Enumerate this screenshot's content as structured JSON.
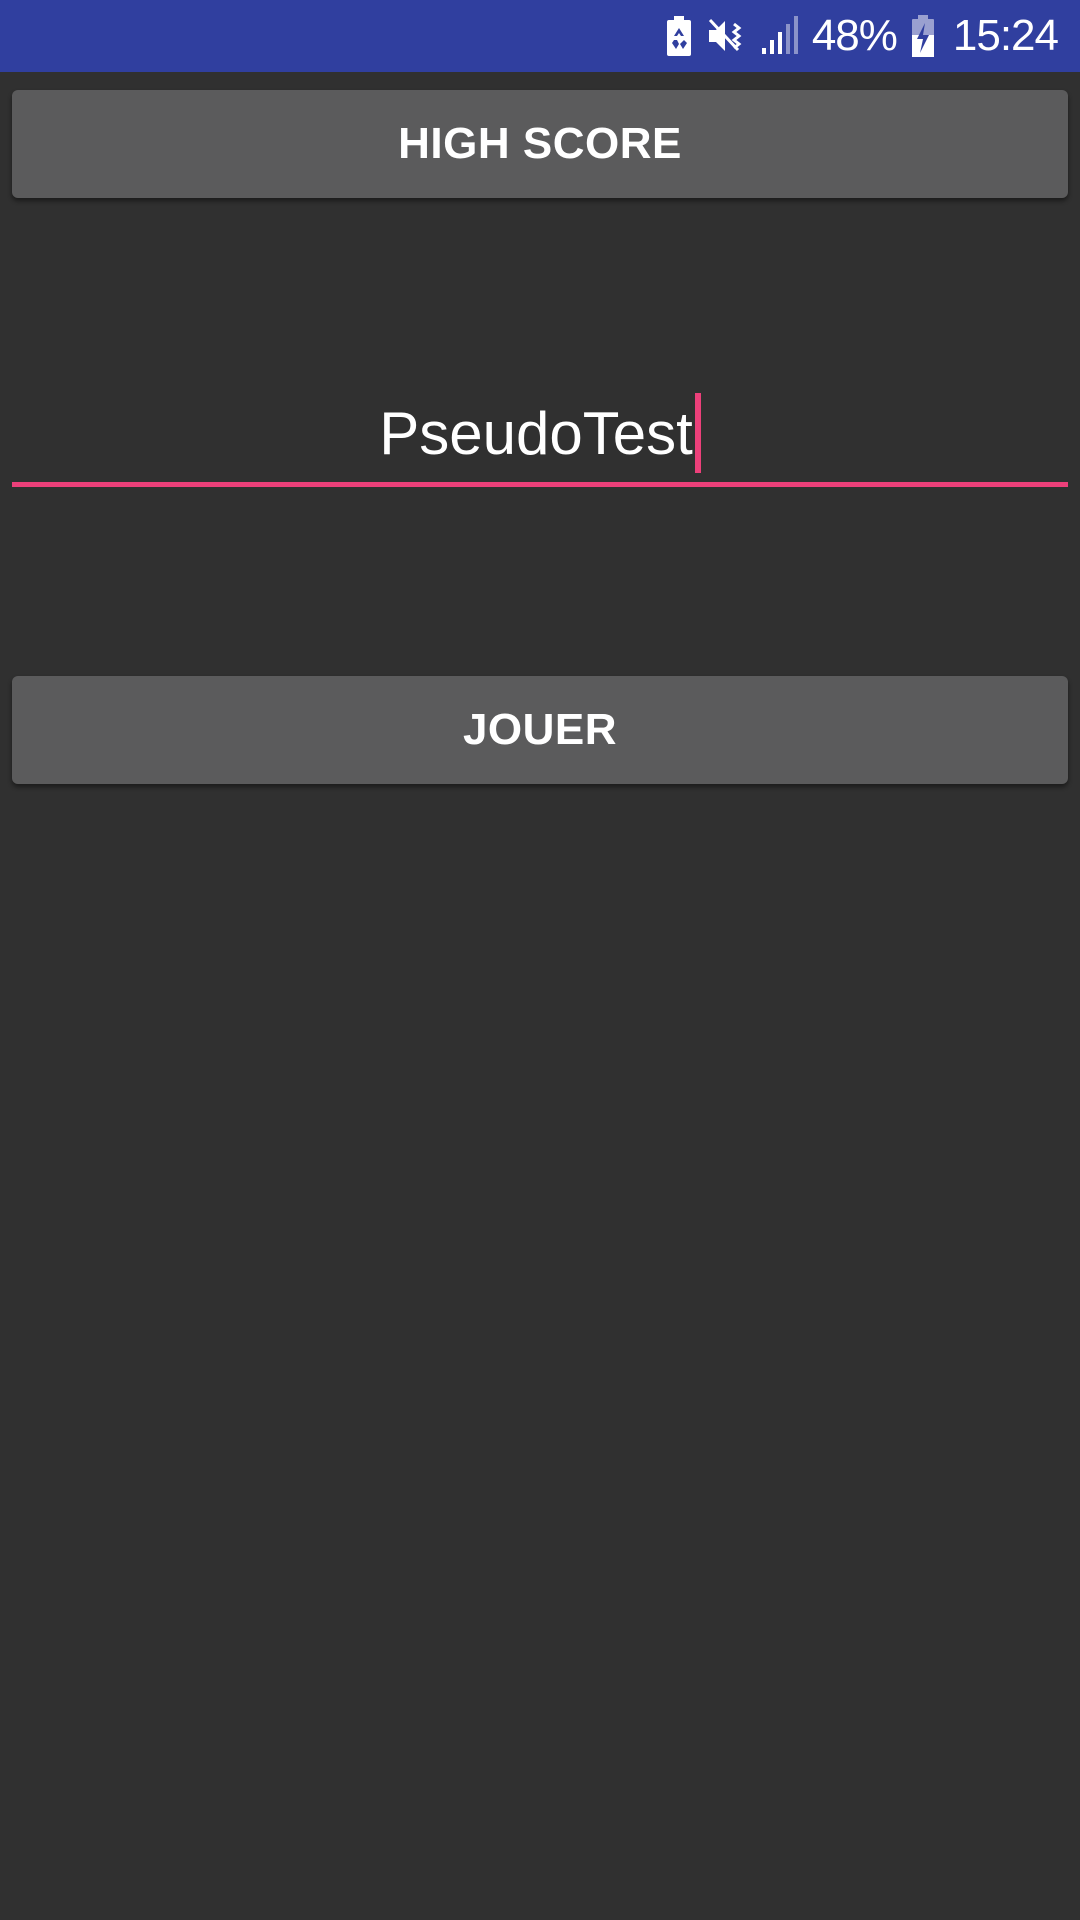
{
  "status_bar": {
    "battery_percent": "48%",
    "time": "15:24",
    "background_color": "#303F9F",
    "icons": [
      "battery-saver-icon",
      "vibrate-mode-icon",
      "signal-icon",
      "battery-charging-icon"
    ]
  },
  "buttons": {
    "high_score_label": "HIGH SCORE",
    "play_label": "JOUER"
  },
  "pseudo_input": {
    "value": "PseudoTest",
    "accent_color": "#ec407a"
  },
  "colors": {
    "background": "#303030",
    "button": "#5b5b5c"
  }
}
